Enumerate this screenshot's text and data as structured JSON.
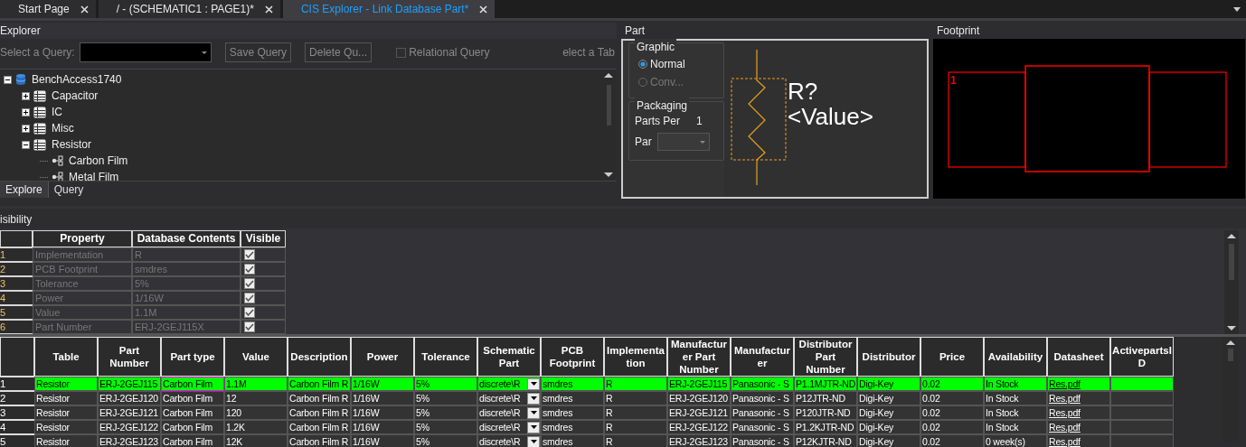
{
  "tabs": [
    {
      "label": "Start Page",
      "selected": false
    },
    {
      "label": "/ - (SCHEMATIC1 : PAGE1)*",
      "selected": false
    },
    {
      "label": "CIS Explorer - Link Database Part*",
      "selected": true
    }
  ],
  "explorer": {
    "title": "Explorer",
    "query_label": "Select a Query:",
    "buttons": [
      "Save Query",
      "Delete Qu..."
    ],
    "relational_query": {
      "label": "Relational Query",
      "checked": false
    },
    "table_label": "elect a Tab",
    "tree": [
      {
        "label": "BenchAccess1740",
        "kind": "database",
        "expanded": true,
        "children": [
          {
            "label": "Capacitor",
            "kind": "table",
            "expanded": false
          },
          {
            "label": "IC",
            "kind": "table",
            "expanded": false
          },
          {
            "label": "Misc",
            "kind": "table",
            "expanded": false
          },
          {
            "label": "Resistor",
            "kind": "table",
            "expanded": true,
            "children": [
              {
                "label": "Carbon Film",
                "kind": "query"
              },
              {
                "label": "Metal Film",
                "kind": "query"
              }
            ]
          }
        ]
      }
    ],
    "bottom_tabs": [
      {
        "label": "Explore",
        "selected": true
      },
      {
        "label": "Query",
        "selected": false
      }
    ]
  },
  "part": {
    "title": "Part",
    "graphic": {
      "title": "Graphic",
      "options": [
        {
          "label": "Normal",
          "selected": true,
          "disabled": false
        },
        {
          "label": "Conv...",
          "selected": false,
          "disabled": true
        }
      ]
    },
    "packaging": {
      "title": "Packaging",
      "parts_per_label": "Parts Per",
      "parts_per_value": "1",
      "part_label": "Par"
    },
    "symbol": {
      "reference": "R?",
      "value": "<Value>"
    }
  },
  "footprint": {
    "title": "Footprint",
    "pin_label": "1"
  },
  "visibility": {
    "title": "isibility",
    "columns": [
      "Property",
      "Database Contents",
      "Visible"
    ],
    "rows": [
      {
        "number": "1",
        "property": "Implementation",
        "contents": "R",
        "visible": true
      },
      {
        "number": "2",
        "property": "PCB Footprint",
        "contents": "smdres",
        "visible": true
      },
      {
        "number": "3",
        "property": "Tolerance",
        "contents": "5%",
        "visible": true
      },
      {
        "number": "4",
        "property": "Power",
        "contents": "1/16W",
        "visible": true
      },
      {
        "number": "5",
        "property": "Value",
        "contents": "1.1M",
        "visible": true
      },
      {
        "number": "6",
        "property": "Part Number",
        "contents": "ERJ-2GEJ115X",
        "visible": true
      }
    ]
  },
  "grid": {
    "columns": [
      {
        "label": "Table",
        "kind": "text",
        "focused": false
      },
      {
        "label": "Part Number",
        "kind": "text",
        "focused": false
      },
      {
        "label": "Part type",
        "kind": "text",
        "focused": true
      },
      {
        "label": "Value",
        "kind": "text",
        "focused": false
      },
      {
        "label": "Description",
        "kind": "text",
        "focused": false
      },
      {
        "label": "Power",
        "kind": "text",
        "focused": false
      },
      {
        "label": "Tolerance",
        "kind": "text",
        "focused": false
      },
      {
        "label": "Schematic Part",
        "kind": "dropdown",
        "focused": false
      },
      {
        "label": "PCB Footprint",
        "kind": "text",
        "focused": false
      },
      {
        "label": "Implementation",
        "kind": "text",
        "focused": false
      },
      {
        "label": "Manufacturer Part Number",
        "kind": "text",
        "focused": false
      },
      {
        "label": "Manufacturer",
        "kind": "text",
        "focused": false
      },
      {
        "label": "Distributor Part Number",
        "kind": "text",
        "focused": false
      },
      {
        "label": "Distributor",
        "kind": "text",
        "focused": false
      },
      {
        "label": "Price",
        "kind": "text",
        "focused": false
      },
      {
        "label": "Availability",
        "kind": "text",
        "focused": false
      },
      {
        "label": "Datasheet",
        "kind": "link",
        "focused": false
      },
      {
        "label": "ActivepartsID",
        "kind": "text",
        "focused": false
      }
    ],
    "rows": [
      {
        "number": "1",
        "selected": true,
        "cells": [
          "Resistor",
          "ERJ-2GEJ115",
          "Carbon Film",
          "1.1M",
          "Carbon Film R",
          "1/16W",
          "5%",
          "discrete\\R",
          "smdres",
          "R",
          "ERJ-2GEJ115",
          "Panasonic - S",
          "P1.1MJTR-ND",
          "Digi-Key",
          "0.02",
          "In Stock",
          "Res.pdf",
          ""
        ]
      },
      {
        "number": "2",
        "selected": false,
        "cells": [
          "Resistor",
          "ERJ-2GEJ120",
          "Carbon Film",
          "12",
          "Carbon Film R",
          "1/16W",
          "5%",
          "discrete\\R",
          "smdres",
          "R",
          "ERJ-2GEJ120",
          "Panasonic - S",
          "P12JTR-ND",
          "Digi-Key",
          "0.02",
          "In Stock",
          "Res.pdf",
          ""
        ]
      },
      {
        "number": "3",
        "selected": false,
        "cells": [
          "Resistor",
          "ERJ-2GEJ121",
          "Carbon Film",
          "120",
          "Carbon Film R",
          "1/16W",
          "5%",
          "discrete\\R",
          "smdres",
          "R",
          "ERJ-2GEJ121",
          "Panasonic - S",
          "P120JTR-ND",
          "Digi-Key",
          "0.02",
          "In Stock",
          "Res.pdf",
          ""
        ]
      },
      {
        "number": "4",
        "selected": false,
        "cells": [
          "Resistor",
          "ERJ-2GEJ122",
          "Carbon Film",
          "1.2K",
          "Carbon Film R",
          "1/16W",
          "5%",
          "discrete\\R",
          "smdres",
          "R",
          "ERJ-2GEJ122",
          "Panasonic - S",
          "P1.2KJTR-ND",
          "Digi-Key",
          "0.02",
          "In Stock",
          "Res.pdf",
          ""
        ]
      },
      {
        "number": "5",
        "selected": false,
        "cells": [
          "Resistor",
          "ERJ-2GEJ123",
          "Carbon Film",
          "12K",
          "Carbon Film R",
          "1/16W",
          "5%",
          "discrete\\R",
          "smdres",
          "R",
          "ERJ-2GEJ123",
          "Panasonic - S",
          "P12KJTR-ND",
          "Digi-Key",
          "0.02",
          "0 week(s)",
          "Res.pdf",
          ""
        ]
      }
    ]
  }
}
